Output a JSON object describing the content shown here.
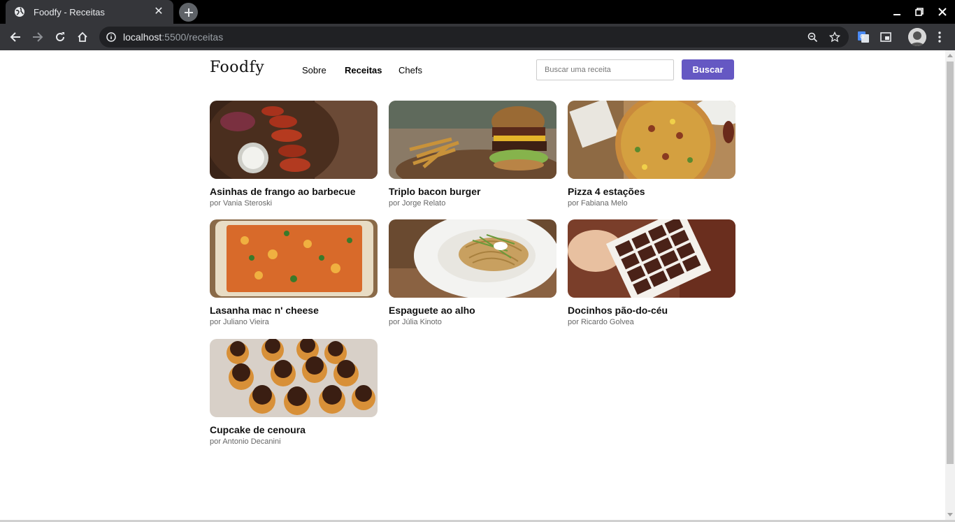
{
  "browser": {
    "tab_title": "Foodfy - Receitas",
    "url_host": "localhost",
    "url_rest": ":5500/receitas"
  },
  "site": {
    "logo": "Foodfy",
    "nav": {
      "about": "Sobre",
      "recipes": "Receitas",
      "chefs": "Chefs"
    },
    "search": {
      "placeholder": "Buscar uma receita",
      "button_label": "Buscar"
    }
  },
  "recipes": [
    {
      "title": "Asinhas de frango ao barbecue",
      "author": "por Vania Steroski"
    },
    {
      "title": "Triplo bacon burger",
      "author": "por Jorge Relato"
    },
    {
      "title": "Pizza 4 estações",
      "author": "por Fabiana Melo"
    },
    {
      "title": "Lasanha mac n' cheese",
      "author": "por Juliano Vieira"
    },
    {
      "title": "Espaguete ao alho",
      "author": "por Júlia Kinoto"
    },
    {
      "title": "Docinhos pão-do-céu",
      "author": "por Ricardo Golvea"
    },
    {
      "title": "Cupcake de cenoura",
      "author": "por Antonio Decanini"
    }
  ],
  "colors": {
    "accent": "#6558c3",
    "chrome_dark": "#35363a"
  }
}
